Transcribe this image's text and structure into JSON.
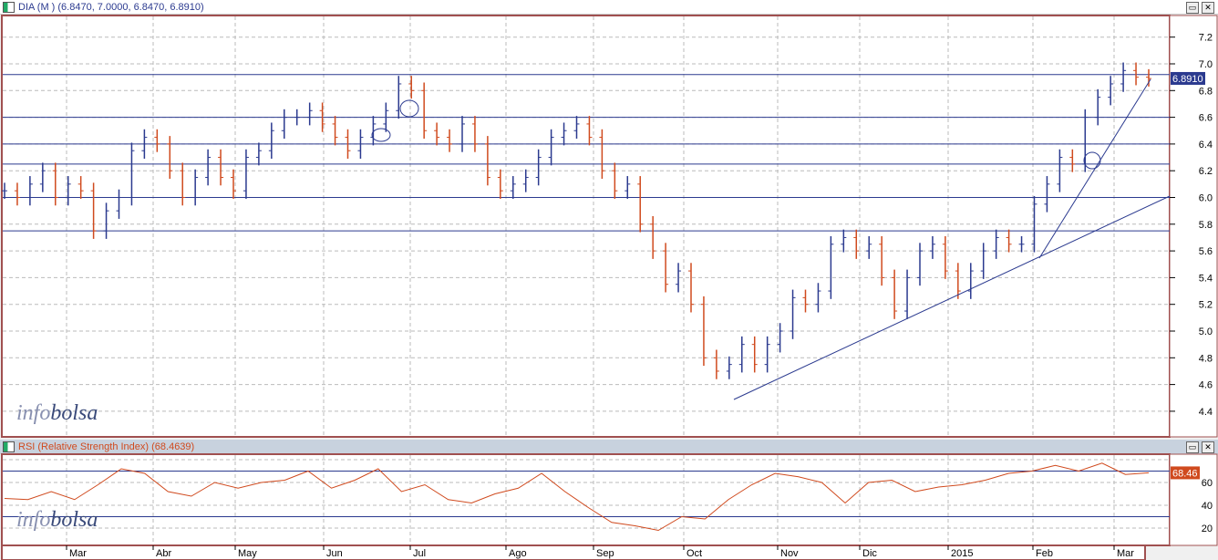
{
  "price_panel": {
    "title": "DIA (M ) (6.8470, 7.0000, 6.8470, 6.8910)",
    "last_value": "6.8910",
    "y_ticks": [
      "7.2",
      "7.0",
      "6.8",
      "6.6",
      "6.4",
      "6.2",
      "6.0",
      "5.8",
      "5.6",
      "5.4",
      "5.2",
      "5.0",
      "4.8",
      "4.6",
      "4.4"
    ],
    "watermark": {
      "a": "info",
      "b": "bolsa"
    }
  },
  "rsi_panel": {
    "title": "RSI (Relative Strength Index) (68.4639)",
    "last_value": "68.46",
    "y_ticks": [
      "60",
      "40",
      "20"
    ],
    "watermark": {
      "a": "info",
      "b": "bolsa"
    }
  },
  "x_labels": [
    "Mar",
    "Abr",
    "May",
    "Jun",
    "Jul",
    "Ago",
    "Sep",
    "Oct",
    "Nov",
    "Dic",
    "2015",
    "Feb",
    "Mar"
  ],
  "buttons": {
    "maximize": "▭",
    "close": "✕"
  },
  "colors": {
    "up": "#2b3a8f",
    "down": "#d04a1e",
    "rsi": "#d04a1e"
  },
  "chart_data": {
    "type": "line",
    "price_closes": [
      6.05,
      6.0,
      6.1,
      6.2,
      6.0,
      6.1,
      6.05,
      5.75,
      5.9,
      6.0,
      6.35,
      6.45,
      6.4,
      6.2,
      6.0,
      6.15,
      6.3,
      6.15,
      6.05,
      6.3,
      6.35,
      6.5,
      6.6,
      6.6,
      6.65,
      6.55,
      6.45,
      6.35,
      6.45,
      6.55,
      6.65,
      6.85,
      6.8,
      6.5,
      6.45,
      6.4,
      6.55,
      6.4,
      6.15,
      6.05,
      6.1,
      6.15,
      6.3,
      6.45,
      6.5,
      6.55,
      6.45,
      6.2,
      6.05,
      6.1,
      5.8,
      5.6,
      5.35,
      5.45,
      5.2,
      4.8,
      4.7,
      4.75,
      4.9,
      4.75,
      4.9,
      5.0,
      5.25,
      5.2,
      5.3,
      5.65,
      5.7,
      5.6,
      5.65,
      5.4,
      5.15,
      5.4,
      5.6,
      5.65,
      5.45,
      5.3,
      5.45,
      5.6,
      5.7,
      5.65,
      5.65,
      5.95,
      6.1,
      6.3,
      6.25,
      6.6,
      6.75,
      6.85,
      6.95,
      6.9,
      6.89
    ],
    "price_range": [
      4.3,
      7.3
    ],
    "support_levels": [
      6.92,
      6.6,
      6.4,
      6.25,
      6.0,
      5.75
    ],
    "rsi_values": [
      46,
      45,
      52,
      45,
      58,
      72,
      68,
      52,
      48,
      60,
      55,
      60,
      62,
      70,
      55,
      62,
      72,
      52,
      58,
      45,
      42,
      50,
      55,
      68,
      52,
      38,
      25,
      22,
      18,
      30,
      28,
      45,
      58,
      68,
      65,
      60,
      42,
      60,
      62,
      52,
      56,
      58,
      62,
      68,
      70,
      75,
      70,
      77,
      67,
      68.5
    ],
    "rsi_levels": [
      70,
      30
    ],
    "rsi_range": [
      10,
      85
    ]
  }
}
